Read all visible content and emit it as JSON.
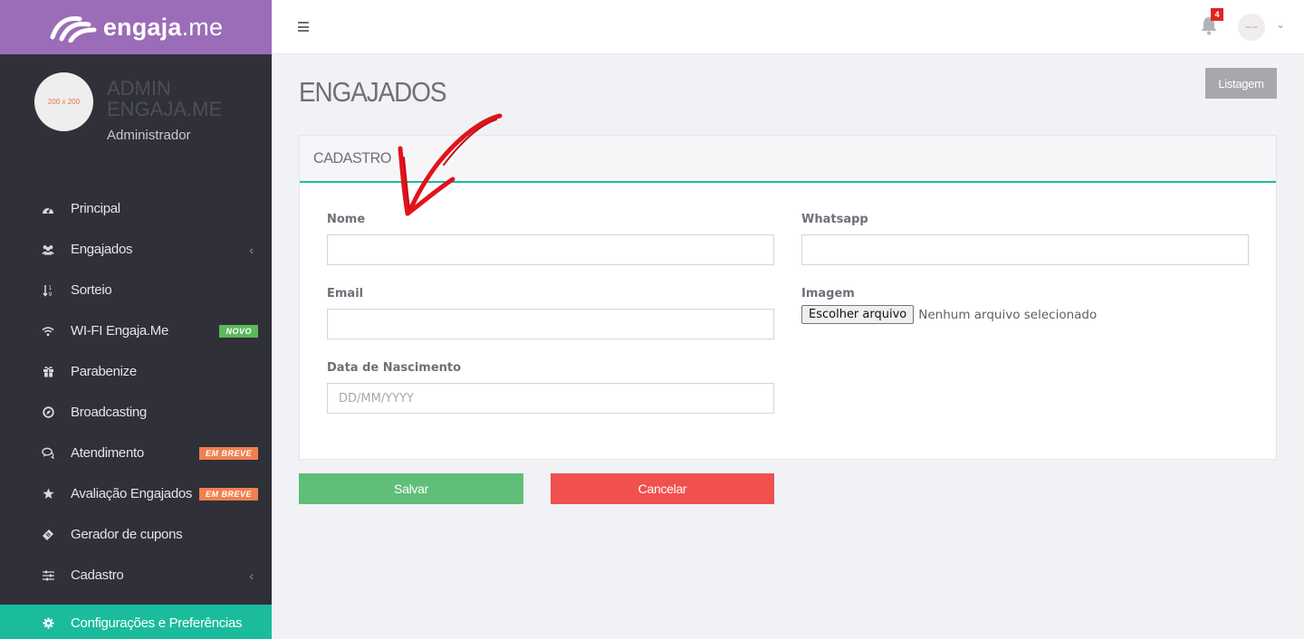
{
  "brand": {
    "name_bold": "engaja",
    "name_thin": ".me"
  },
  "profile": {
    "avatar_text": "200 x 200",
    "name": "ADMIN ENGAJA.ME",
    "role": "Administrador"
  },
  "sidebar": {
    "items": [
      {
        "label": "Principal",
        "icon": "dashboard-icon"
      },
      {
        "label": "Engajados",
        "icon": "users-icon",
        "chevron": "‹"
      },
      {
        "label": "Sorteio",
        "icon": "sort-icon"
      },
      {
        "label": "WI-FI Engaja.Me",
        "icon": "wifi-icon",
        "badge": "NOVO"
      },
      {
        "label": "Parabenize",
        "icon": "gift-icon"
      },
      {
        "label": "Broadcasting",
        "icon": "compass-icon"
      },
      {
        "label": "Atendimento",
        "icon": "chat-icon",
        "badge": "EM BREVE"
      },
      {
        "label": "Avaliação Engajados",
        "icon": "star-icon",
        "badge": "EM BREVE"
      },
      {
        "label": "Gerador de cupons",
        "icon": "ticket-icon"
      },
      {
        "label": "Cadastro",
        "icon": "sliders-icon",
        "chevron": "‹"
      },
      {
        "label": "Configurações e Preferências",
        "icon": "gear-icon"
      }
    ]
  },
  "topbar": {
    "notification_count": "4",
    "avatar_text": "200 x 200",
    "chevron": "⌄"
  },
  "page": {
    "title": "ENGAJADOS",
    "listagem_label": "Listagem",
    "panel_title": "CADASTRO"
  },
  "form": {
    "nome_label": "Nome",
    "whatsapp_label": "Whatsapp",
    "email_label": "Email",
    "imagem_label": "Imagem",
    "file_button": "Escolher arquivo",
    "file_status": "Nenhum arquivo selecionado",
    "nascimento_label": "Data de Nascimento",
    "nascimento_placeholder": "DD/MM/YYYY"
  },
  "actions": {
    "save_label": "Salvar",
    "cancel_label": "Cancelar"
  },
  "colors": {
    "brand": "#9b6cb7",
    "sidebar": "#2f3038",
    "accent": "#1abc9c",
    "save": "#5fbe77",
    "cancel": "#f0504e",
    "badge_new": "#5cb85c",
    "badge_soon": "#f0804f",
    "arrow": "#e0141c"
  }
}
